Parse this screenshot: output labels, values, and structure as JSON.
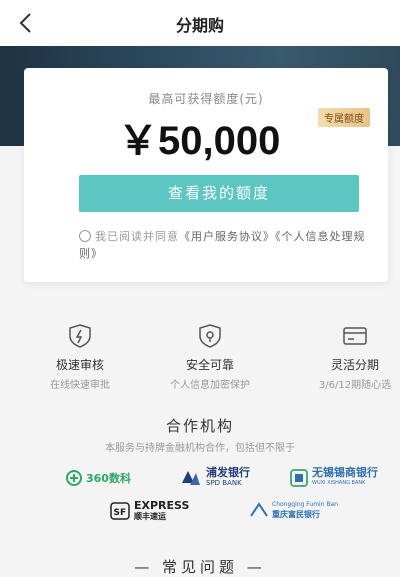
{
  "header": {
    "title": "分期购",
    "back_icon": "chevron-left-icon"
  },
  "card": {
    "limit_label": "最高可获得额度(元)",
    "amount": "￥50,000",
    "badge": "专属额度",
    "button_label": "查看我的额度",
    "agree_prefix": "我已阅读并同意",
    "agree_links": "《用户服务协议》《个人信息处理规则》"
  },
  "features": [
    {
      "title": "极速审核",
      "subtitle": "在线快速审批",
      "icon": "bolt-shield-icon"
    },
    {
      "title": "安全可靠",
      "subtitle": "个人信息加密保护",
      "icon": "shield-check-icon"
    },
    {
      "title": "灵活分期",
      "subtitle": "3/6/12期随心选",
      "icon": "card-icon"
    }
  ],
  "partners": {
    "title": "合作机构",
    "subtitle": "本服务与持牌金融机构合作，包括但不限于",
    "logos": [
      {
        "name": "360数科"
      },
      {
        "name": "浦发银行",
        "sub": "SPD BANK"
      },
      {
        "name": "无锡锡商银行",
        "sub": "WUXI XISHANG BANK"
      },
      {
        "name": "EXPRESS",
        "sub": "顺丰速运"
      },
      {
        "name": "Chongqing Fumin Ban",
        "sub": "重庆富民银行"
      }
    ]
  },
  "faq": {
    "title": "常见问题"
  },
  "colors": {
    "accent": "#5cc6c3",
    "hero": "#2b475c",
    "badge": "#e8c389"
  }
}
